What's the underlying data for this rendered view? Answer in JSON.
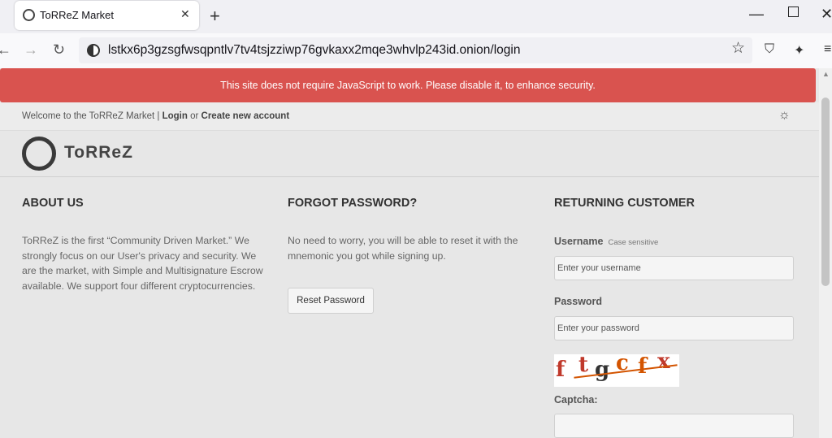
{
  "browser": {
    "tab_title": "ToRReZ Market",
    "url": "lstkx6p3gzsgfwsqpntlv7tv4tsjzziwp76gvkaxx2mqe3whvlp243id.onion/login"
  },
  "site": {
    "alert": "This site does not require JavaScript to work. Please disable it, to enhance security.",
    "welcome_text": "Welcome to the ToRReZ Market |",
    "login_link": "Login",
    "or_text": "or",
    "register_link": "Create new account",
    "logo_text": "ToRReZ",
    "about": {
      "heading": "ABOUT US",
      "text": "ToRReZ is the first “Community Driven Market.” We strongly focus on our User's privacy and security. We are the market, with Simple and Multisignature Escrow available. We support four different cryptocurrencies."
    },
    "forgot": {
      "heading": "FORGOT PASSWORD?",
      "text": "No need to worry, you will be able to reset it with the mnemonic you got while signing up.",
      "button": "Reset Password"
    },
    "login_form": {
      "heading": "RETURNING CUSTOMER",
      "username_label": "Username",
      "username_hint": "Case sensitive",
      "username_placeholder": "Enter your username",
      "password_label": "Password",
      "password_placeholder": "Enter your password",
      "captcha_text": "ftgcfx",
      "captcha_label": "Captcha:"
    }
  },
  "colors": {
    "alert_bg": "#d9534f",
    "page_bg": "#e7e7e7",
    "captcha_red": "#c0392b",
    "captcha_orange": "#d35400"
  }
}
